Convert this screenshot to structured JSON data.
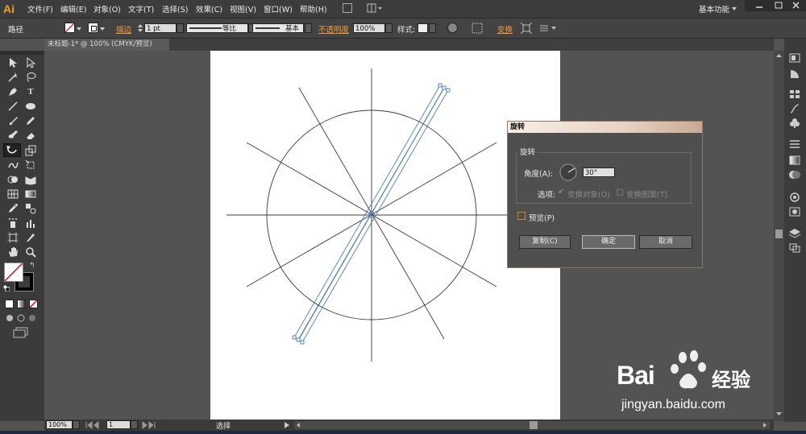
{
  "app": {
    "logo": "Ai"
  },
  "menu": [
    "文件(F)",
    "编辑(E)",
    "对象(O)",
    "文字(T)",
    "选择(S)",
    "效果(C)",
    "视图(V)",
    "窗口(W)",
    "帮助(H)"
  ],
  "workspace": {
    "label": "基本功能"
  },
  "control": {
    "object_type": "路径",
    "stroke_label": "描边",
    "stroke_weight": "1 pt",
    "profile_equal": "等比",
    "profile_basic": "基本",
    "opacity_label": "不透明度",
    "opacity_value": "100%",
    "style_label": "样式:",
    "transform_label": "变换"
  },
  "document": {
    "tab_title": "未标题-1* @ 100% (CMYK/预览)"
  },
  "status": {
    "zoom": "100%",
    "page": "1",
    "mode": "选择"
  },
  "dialog": {
    "title": "旋转",
    "group_label": "旋转",
    "angle_label": "角度(A):",
    "angle_value": "30°",
    "options_label": "选项:",
    "transform_objects": "变换对象(O)",
    "transform_patterns": "变换图案(T)",
    "preview": "预览(P)",
    "copy_button": "复制(C)",
    "ok_button": "确定",
    "cancel_button": "取消"
  },
  "watermark": {
    "brand": "Bai",
    "brand2": "du",
    "cn": "经验",
    "url": "jingyan.baidu.com"
  },
  "icons": [
    "selection-icon",
    "direct-selection-icon",
    "magic-wand-icon",
    "lasso-icon",
    "pen-icon",
    "type-icon",
    "line-icon",
    "ellipse-icon",
    "brush-icon",
    "pencil-icon",
    "blob-brush-icon",
    "eraser-icon",
    "rotate-icon",
    "scale-icon",
    "warp-icon",
    "free-transform-icon",
    "shape-builder-icon",
    "perspective-icon",
    "mesh-icon",
    "gradient-icon",
    "eyedropper-icon",
    "blend-icon",
    "symbol-sprayer-icon",
    "graph-icon",
    "artboard-icon",
    "slice-icon",
    "hand-icon",
    "zoom-icon"
  ],
  "colors": {
    "accent": "#f09a3a",
    "ui_dark": "#3b3b3b",
    "canvas": "#535353",
    "selection": "#4a7fb5"
  }
}
